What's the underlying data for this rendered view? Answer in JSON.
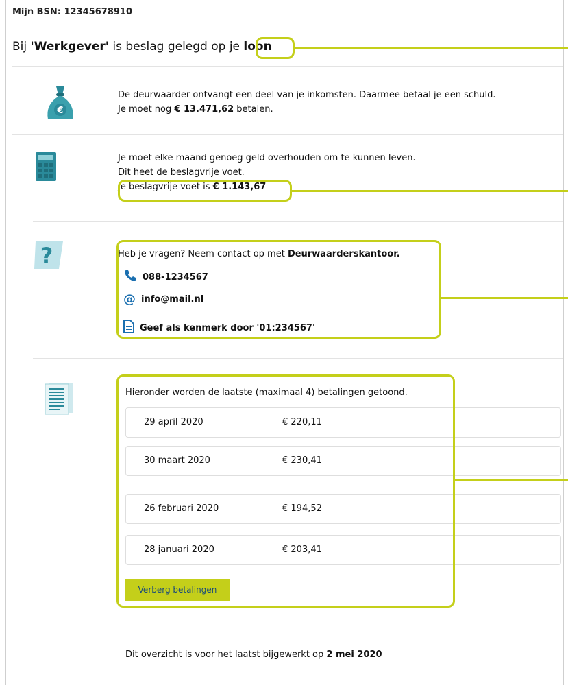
{
  "header": {
    "bsn": "Mijn BSN: 12345678910",
    "title_pre": "Bij ",
    "title_employer": "'Werkgever'",
    "title_mid": " is beslag gelegd op je ",
    "title_word": "loon"
  },
  "income": {
    "line1": "De deurwaarder ontvangt een deel van je inkomsten. Daarmee betaal je een schuld.",
    "line2_pre": "Je moet nog ",
    "line2_amount": "€ 13.471,62",
    "line2_post": " betalen."
  },
  "voet": {
    "line1": "Je moet elke maand genoeg geld overhouden om te kunnen leven.",
    "line2": "Dit heet de beslagvrije voet.",
    "line3_pre": "Je beslagvrije voet is ",
    "line3_amount": "€ 1.143,67"
  },
  "contact": {
    "intro_pre": "Heb je vragen? Neem contact op met ",
    "intro_name": "Deurwaarderskantoor.",
    "phone": "088-1234567",
    "email": "info@mail.nl",
    "reference": "Geef als kenmerk door '01:234567'"
  },
  "payments": {
    "intro": "Hieronder worden de laatste (maximaal 4) betalingen getoond.",
    "rows": [
      {
        "date": "29 april 2020",
        "amount": "€ 220,11"
      },
      {
        "date": "30 maart 2020",
        "amount": "€ 230,41"
      },
      {
        "date": "26 februari 2020",
        "amount": "€ 194,52"
      },
      {
        "date": "28 januari 2020",
        "amount": "€ 203,41"
      }
    ],
    "hide_button": "Verberg betalingen"
  },
  "footer": {
    "updated_pre": "Dit overzicht is voor het laatst bijgewerkt op ",
    "updated_date": "2 mei 2020"
  },
  "colors": {
    "highlight": "#c4cf1a",
    "icon_teal": "#2a8a9a",
    "link_blue": "#1a4b7a"
  }
}
